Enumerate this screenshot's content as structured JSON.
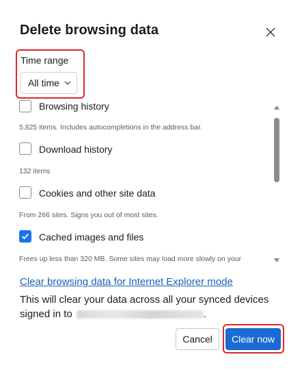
{
  "dialog": {
    "title": "Delete browsing data",
    "close_icon": "close-icon"
  },
  "time_range": {
    "label": "Time range",
    "selected": "All time",
    "icon": "chevron-down-icon"
  },
  "items": [
    {
      "label": "Browsing history",
      "description": "5,825 items. Includes autocompletions in the address bar.",
      "checked": false
    },
    {
      "label": "Download history",
      "description": "132 items",
      "checked": false
    },
    {
      "label": "Cookies and other site data",
      "description": "From 266 sites. Signs you out of most sites.",
      "checked": false
    },
    {
      "label": "Cached images and files",
      "description": "Frees up less than 320 MB. Some sites may load more slowly on your",
      "checked": true
    }
  ],
  "links": {
    "ie_mode": "Clear browsing data for Internet Explorer mode"
  },
  "sync_notice": {
    "text": "This will clear your data across all your synced devices signed in to",
    "suffix": "."
  },
  "buttons": {
    "cancel": "Cancel",
    "clear": "Clear now"
  },
  "colors": {
    "accent": "#1a6ad1",
    "highlight": "#e0252a",
    "link": "#1a5fb4"
  }
}
